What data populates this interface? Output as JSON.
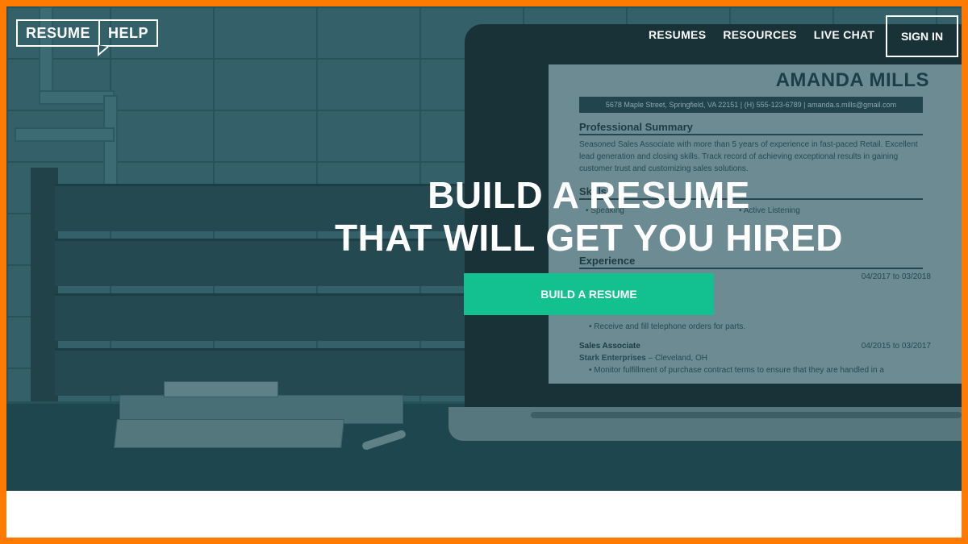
{
  "header": {
    "logo_part1": "RESUME",
    "logo_part2": "HELP",
    "nav": [
      "RESUMES",
      "RESOURCES",
      "LIVE CHAT"
    ],
    "signin_label": "SIGN IN"
  },
  "hero": {
    "headline_line1": "BUILD A RESUME",
    "headline_line2": "THAT WILL GET YOU HIRED",
    "cta_label": "BUILD A RESUME"
  },
  "resume_preview": {
    "name": "AMANDA MILLS",
    "contact": "5678 Maple Street, Springfield, VA 22151 | (H) 555-123-6789 | amanda.s.mills@gmail.com",
    "summary_heading": "Professional Summary",
    "summary_text": "Seasoned Sales Associate with more than 5 years of experience in fast-paced Retail. Excellent lead generation and closing skills. Track record of achieving exceptional results in gaining customer trust and customizing sales solutions.",
    "skills_heading": "Skills",
    "skills": [
      "Speaking",
      "Active Listening"
    ],
    "experience_heading": "Experience",
    "job1_dates": "04/2017 to 03/2018",
    "job1_bullets": [
      "Receive and fill telephone orders for parts."
    ],
    "job2_title": "Sales Associate",
    "job2_company": "Stark Enterprises",
    "job2_location": "– Cleveland, OH",
    "job2_dates": "04/2015 to 03/2017",
    "job2_bullets": [
      "Monitor fulfillment of purchase contract terms to ensure that they are handled in a"
    ]
  },
  "colors": {
    "accent": "#13c08f",
    "frame": "#ff7a00",
    "hero_tint": "#2c5d66"
  }
}
